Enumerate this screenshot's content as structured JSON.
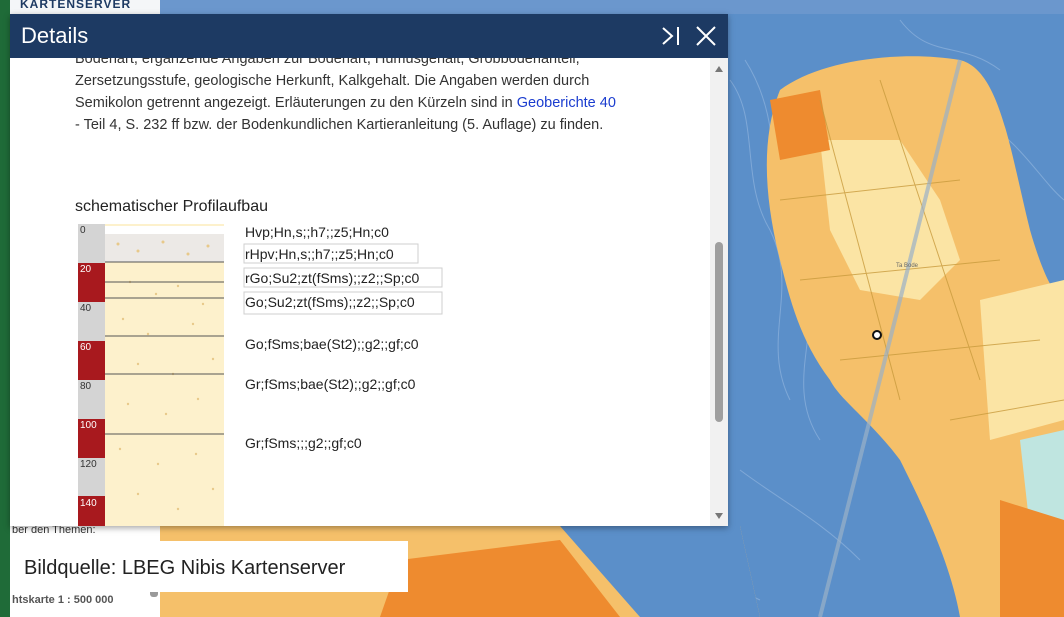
{
  "app": {
    "title": "KARTENSERVER"
  },
  "dialog": {
    "title": "Details",
    "paragraph": {
      "line1": "Bodenart, ergänzende Angaben zur Bodenart, Humusgehalt, Grobbodenanteil,",
      "line2": "Zersetzungsstufe, geologische Herkunft, Kalkgehalt. Die Angaben werden durch",
      "line3_pre": "Semikolon getrennt angezeigt. Erläuterungen zu den Kürzeln sind in ",
      "link": "Geoberichte 40",
      "line4": "- Teil 4, S. 232 ff bzw. der Bodenkundlichen Kartieranleitung (5. Auflage) zu finden."
    },
    "profile": {
      "heading": "schematischer Profilaufbau",
      "depths": [
        "0",
        "20",
        "40",
        "60",
        "80",
        "100",
        "120",
        "140"
      ],
      "horizons": [
        "Hvp;Hn,s;;h7;;z5;Hn;c0",
        "rHpv;Hn,s;;h7;;z5;Hn;c0",
        "rGo;Su2;zt(fSms);;z2;;Sp;c0",
        "Go;Su2;zt(fSms);;z2;;Sp;c0",
        "Go;fSms;bae(St2);;g2;;gf;c0",
        "Gr;fSms;bae(St2);;g2;;gf;c0",
        "Gr;fSms;;;g2;;gf;c0"
      ]
    }
  },
  "sidebar": {
    "hint": "ber den Themen:",
    "scale": "htskarte 1 : 500 000"
  },
  "caption": "Bildquelle: LBEG Nibis Kartenserver",
  "map": {
    "place_label": "Ta Bode"
  },
  "colors": {
    "header": "#1d3a63",
    "accent_green": "#1f6b38",
    "map_water": "#5b8fc9",
    "map_orange": "#f3a03a",
    "map_light": "#fbe4a4",
    "depth_red": "#a8191e",
    "link": "#1a3ccf"
  }
}
